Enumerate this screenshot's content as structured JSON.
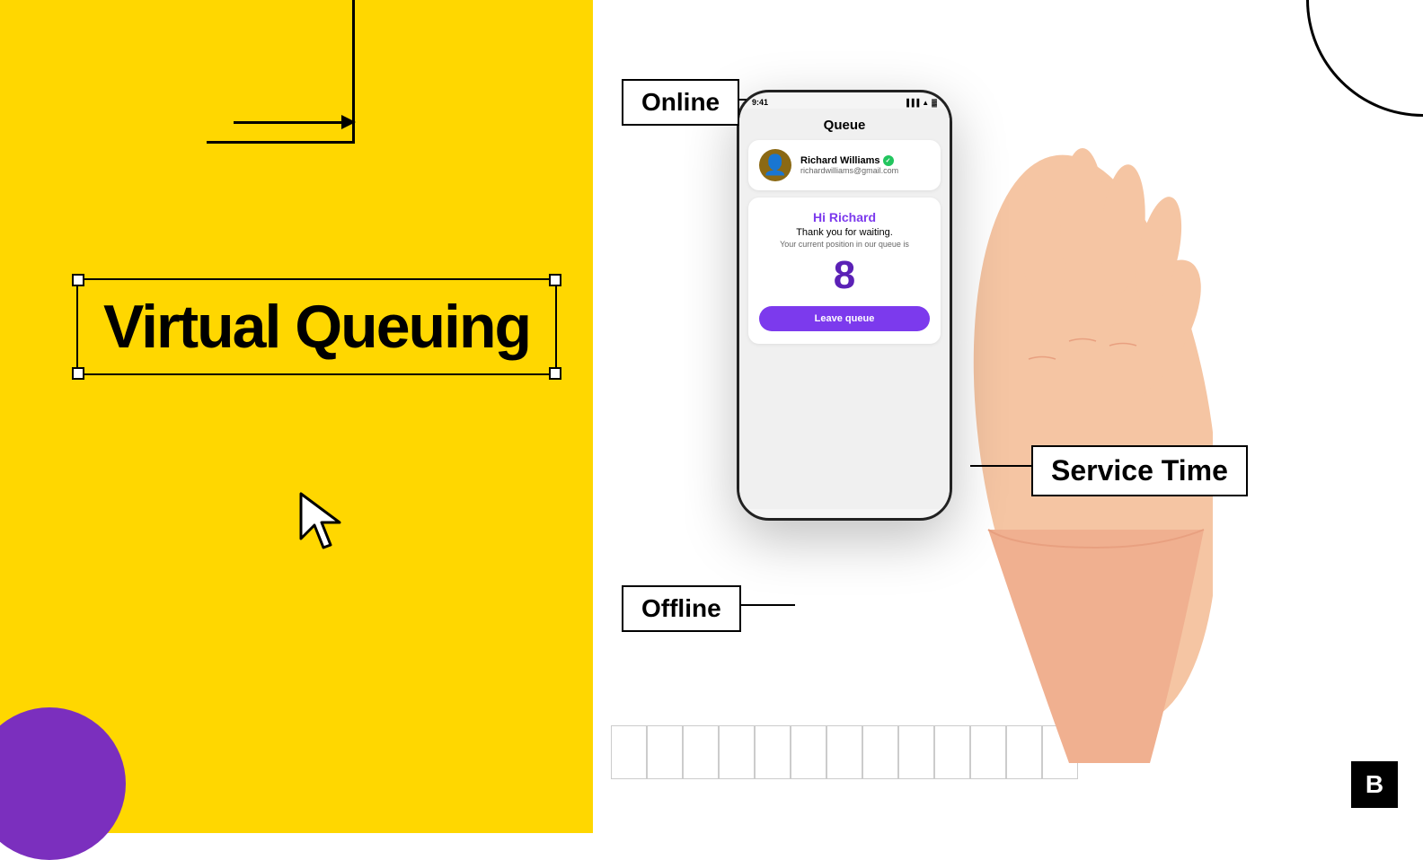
{
  "page": {
    "title": "Virtual Queuing"
  },
  "left": {
    "headline": "Virtual Queuing"
  },
  "labels": {
    "online": "Online",
    "offline": "Offline",
    "service_time": "Service Time"
  },
  "phone": {
    "time": "9:41",
    "screen_title": "Queue",
    "user": {
      "name": "Richard Williams",
      "email": "richardwilliams@gmail.com"
    },
    "greeting": "Hi Richard",
    "thank_you": "Thank you for waiting.",
    "position_text": "Your current position in our queue is",
    "queue_number": "8",
    "leave_button": "Leave queue"
  },
  "logo": {
    "letter": "B"
  }
}
